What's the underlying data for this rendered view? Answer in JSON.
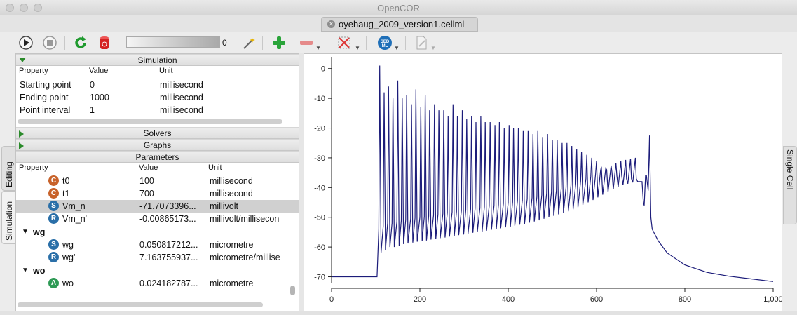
{
  "window": {
    "title": "OpenCOR"
  },
  "file_tab": {
    "label": "oyehaug_2009_version1.cellml",
    "close_icon": "close-icon"
  },
  "toolbar": {
    "slider_value": "0",
    "icons": [
      "run-icon",
      "stop-icon",
      "reset-icon",
      "clear-data-icon",
      "development-mode-icon",
      "add-graph-panel-icon",
      "remove-graph-panel-icon",
      "simulation-data-icon",
      "sedml-export-icon",
      "cellml-export-icon"
    ]
  },
  "side_tabs": {
    "editing": "Editing",
    "simulation": "Simulation",
    "single_cell": "Single Cell"
  },
  "simulation_section": {
    "title": "Simulation",
    "headers": {
      "property": "Property",
      "value": "Value",
      "unit": "Unit"
    },
    "rows": [
      {
        "property": "Starting point",
        "value": "0",
        "unit": "millisecond"
      },
      {
        "property": "Ending point",
        "value": "1000",
        "unit": "millisecond"
      },
      {
        "property": "Point interval",
        "value": "1",
        "unit": "millisecond"
      }
    ]
  },
  "solvers_section": {
    "title": "Solvers"
  },
  "graphs_section": {
    "title": "Graphs"
  },
  "parameters_section": {
    "title": "Parameters",
    "headers": {
      "property": "Property",
      "value": "Value",
      "unit": "Unit"
    },
    "rows": [
      {
        "badge": "C",
        "name": "t0",
        "value": "100",
        "unit": "millisecond"
      },
      {
        "badge": "C",
        "name": "t1",
        "value": "700",
        "unit": "millisecond"
      },
      {
        "badge": "S",
        "name": "Vm_n",
        "value": "-71.7073396...",
        "unit": "millivolt"
      },
      {
        "badge": "R",
        "name": "Vm_n'",
        "value": "-0.00865173...",
        "unit": "millivolt/millisecon"
      },
      {
        "group": "wg"
      },
      {
        "badge": "S",
        "name": "wg",
        "value": "0.050817212...",
        "unit": "micrometre"
      },
      {
        "badge": "R",
        "name": "wg'",
        "value": "7.163755937...",
        "unit": "micrometre/millise"
      },
      {
        "group": "wo"
      },
      {
        "badge": "A",
        "name": "wo",
        "value": "0.024182787...",
        "unit": "micrometre"
      }
    ]
  },
  "colors": {
    "trace": "#1c1c7a",
    "accent_green": "#2a8a2a"
  },
  "chart_data": {
    "type": "line",
    "title": "",
    "xlabel": "",
    "ylabel": "",
    "xlim": [
      0,
      1000
    ],
    "ylim": [
      -72,
      3
    ],
    "x_ticks": [
      0,
      200,
      400,
      600,
      800,
      1000
    ],
    "x_tick_labels": [
      "0",
      "200",
      "400",
      "600",
      "800",
      "1,000"
    ],
    "y_ticks": [
      0,
      -10,
      -20,
      -30,
      -40,
      -50,
      -60,
      -70
    ],
    "y_tick_labels": [
      "0",
      "-10",
      "-20",
      "-30",
      "-40",
      "-50",
      "-60",
      "-70"
    ],
    "grid": false,
    "series": [
      {
        "resting_until": 103,
        "resting_value": -70,
        "spike_times": [
          109,
          119,
          129,
          139,
          150,
          160,
          170,
          181,
          191,
          202,
          212,
          222,
          233,
          243,
          254,
          264,
          275,
          285,
          296,
          306,
          317,
          327,
          338,
          348,
          359,
          370,
          380,
          391,
          402,
          412,
          423,
          434,
          445,
          456,
          467,
          478,
          489,
          500,
          511,
          522,
          533,
          544,
          555,
          566,
          578,
          589,
          600,
          611,
          623,
          635,
          646,
          657,
          668,
          679,
          690
        ],
        "spike_peaks": [
          1,
          -8,
          -6,
          -10,
          -4,
          -10,
          -9,
          -12,
          -7,
          -13,
          -9,
          -14,
          -12,
          -14,
          -14,
          -16,
          -12,
          -16,
          -14,
          -17,
          -16,
          -18,
          -16,
          -18,
          -18,
          -19,
          -18,
          -20,
          -19,
          -20,
          -20,
          -21,
          -21,
          -22,
          -21,
          -23,
          -22,
          -24,
          -24,
          -25,
          -25,
          -26,
          -27,
          -28,
          -29,
          -30,
          -31,
          -33,
          -34,
          -35,
          -36,
          -36,
          -37,
          -37,
          -37
        ],
        "troughs": [
          -62,
          -61,
          -60,
          -60,
          -59.5,
          -59,
          -58.8,
          -58.5,
          -58.2,
          -58,
          -57.8,
          -57.5,
          -57.3,
          -57,
          -56.8,
          -56.5,
          -56.2,
          -56,
          -55.8,
          -55.5,
          -55.2,
          -55,
          -54.8,
          -54.5,
          -54.2,
          -54,
          -53.7,
          -53.4,
          -53.1,
          -52.8,
          -52.5,
          -52.2,
          -51.8,
          -51.4,
          -51,
          -50.5,
          -50,
          -49.5,
          -49,
          -48.5,
          -48,
          -47.3,
          -46.6,
          -45.8,
          -45,
          -44.2,
          -43.3,
          -42.4,
          -41.5,
          -40.6,
          -39.8,
          -39.2,
          -38.7,
          -38.3,
          -38
        ],
        "tail": [
          [
            703,
            -38
          ],
          [
            706,
            -45
          ],
          [
            708,
            -46
          ],
          [
            711,
            -36
          ],
          [
            713,
            -36
          ],
          [
            717,
            -41
          ],
          [
            720,
            -22.5
          ],
          [
            723,
            -50
          ],
          [
            726,
            -54
          ],
          [
            740,
            -58
          ],
          [
            760,
            -62
          ],
          [
            800,
            -66
          ],
          [
            850,
            -68.5
          ],
          [
            900,
            -69.8
          ],
          [
            950,
            -70.7
          ],
          [
            1000,
            -71.6
          ]
        ]
      }
    ]
  }
}
